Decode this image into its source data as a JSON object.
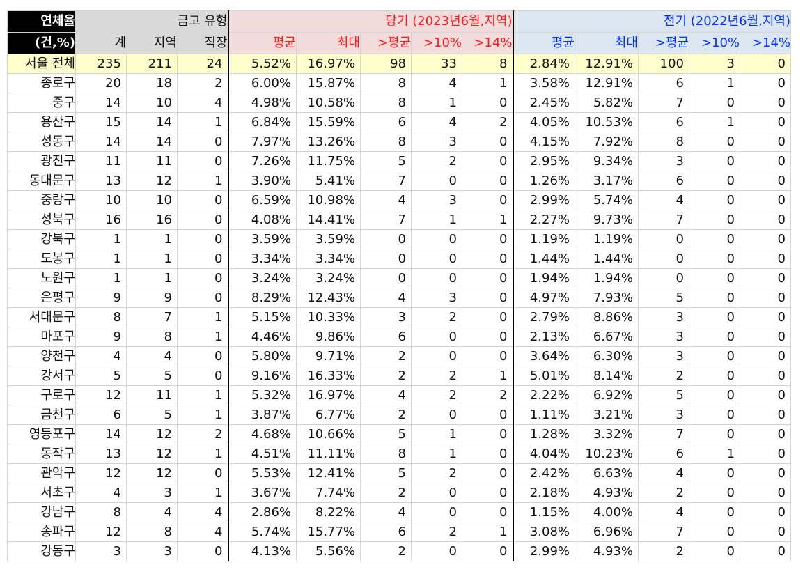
{
  "header": {
    "corner_top": "연체율",
    "corner_bottom": "(건,%)",
    "type_group": "금고 유형",
    "current_group": "당기 (2023년6월,지역)",
    "prior_group": "전기 (2022년6월,지역)",
    "sub": [
      "계",
      "지역",
      "직장",
      "평균",
      "최대",
      ">평균",
      ">10%",
      ">14%",
      "평균",
      "최대",
      ">평균",
      ">10%",
      ">14%"
    ]
  },
  "total": {
    "label": "서울 전체",
    "cells": [
      "235",
      "211",
      "24",
      "5.52%",
      "16.97%",
      "98",
      "33",
      "8",
      "2.84%",
      "12.91%",
      "100",
      "3",
      "0"
    ]
  },
  "rows": [
    {
      "label": "종로구",
      "cells": [
        "20",
        "18",
        "2",
        "6.00%",
        "15.87%",
        "8",
        "4",
        "1",
        "3.58%",
        "12.91%",
        "6",
        "1",
        "0"
      ]
    },
    {
      "label": "중구",
      "cells": [
        "14",
        "10",
        "4",
        "4.98%",
        "10.58%",
        "8",
        "1",
        "0",
        "2.45%",
        "5.82%",
        "7",
        "0",
        "0"
      ]
    },
    {
      "label": "용산구",
      "cells": [
        "15",
        "14",
        "1",
        "6.84%",
        "15.59%",
        "6",
        "4",
        "2",
        "4.05%",
        "10.53%",
        "6",
        "1",
        "0"
      ]
    },
    {
      "label": "성동구",
      "cells": [
        "14",
        "14",
        "0",
        "7.97%",
        "13.26%",
        "8",
        "3",
        "0",
        "4.15%",
        "7.92%",
        "8",
        "0",
        "0"
      ]
    },
    {
      "label": "광진구",
      "cells": [
        "11",
        "11",
        "0",
        "7.26%",
        "11.75%",
        "5",
        "2",
        "0",
        "2.95%",
        "9.34%",
        "3",
        "0",
        "0"
      ]
    },
    {
      "label": "동대문구",
      "cells": [
        "13",
        "12",
        "1",
        "3.90%",
        "5.41%",
        "7",
        "0",
        "0",
        "1.26%",
        "3.17%",
        "6",
        "0",
        "0"
      ]
    },
    {
      "label": "중랑구",
      "cells": [
        "10",
        "10",
        "0",
        "6.59%",
        "10.98%",
        "4",
        "3",
        "0",
        "2.99%",
        "5.74%",
        "4",
        "0",
        "0"
      ]
    },
    {
      "label": "성북구",
      "cells": [
        "16",
        "16",
        "0",
        "4.08%",
        "14.41%",
        "7",
        "1",
        "1",
        "2.27%",
        "9.73%",
        "7",
        "0",
        "0"
      ]
    },
    {
      "label": "강북구",
      "cells": [
        "1",
        "1",
        "0",
        "3.59%",
        "3.59%",
        "0",
        "0",
        "0",
        "1.19%",
        "1.19%",
        "0",
        "0",
        "0"
      ]
    },
    {
      "label": "도봉구",
      "cells": [
        "1",
        "1",
        "0",
        "3.34%",
        "3.34%",
        "0",
        "0",
        "0",
        "1.44%",
        "1.44%",
        "0",
        "0",
        "0"
      ]
    },
    {
      "label": "노원구",
      "cells": [
        "1",
        "1",
        "0",
        "3.24%",
        "3.24%",
        "0",
        "0",
        "0",
        "1.94%",
        "1.94%",
        "0",
        "0",
        "0"
      ]
    },
    {
      "label": "은평구",
      "cells": [
        "9",
        "9",
        "0",
        "8.29%",
        "12.43%",
        "4",
        "3",
        "0",
        "4.97%",
        "7.93%",
        "5",
        "0",
        "0"
      ]
    },
    {
      "label": "서대문구",
      "cells": [
        "8",
        "7",
        "1",
        "5.15%",
        "10.33%",
        "3",
        "2",
        "0",
        "2.79%",
        "8.86%",
        "3",
        "0",
        "0"
      ]
    },
    {
      "label": "마포구",
      "cells": [
        "9",
        "8",
        "1",
        "4.46%",
        "9.86%",
        "6",
        "0",
        "0",
        "2.13%",
        "6.67%",
        "3",
        "0",
        "0"
      ]
    },
    {
      "label": "양천구",
      "cells": [
        "4",
        "4",
        "0",
        "5.80%",
        "9.71%",
        "2",
        "0",
        "0",
        "3.64%",
        "6.30%",
        "3",
        "0",
        "0"
      ]
    },
    {
      "label": "강서구",
      "cells": [
        "5",
        "5",
        "0",
        "9.16%",
        "16.33%",
        "2",
        "2",
        "1",
        "5.01%",
        "8.14%",
        "2",
        "0",
        "0"
      ]
    },
    {
      "label": "구로구",
      "cells": [
        "12",
        "11",
        "1",
        "5.32%",
        "16.97%",
        "4",
        "2",
        "2",
        "2.22%",
        "6.92%",
        "5",
        "0",
        "0"
      ]
    },
    {
      "label": "금천구",
      "cells": [
        "6",
        "5",
        "1",
        "3.87%",
        "6.77%",
        "2",
        "0",
        "0",
        "1.11%",
        "3.21%",
        "3",
        "0",
        "0"
      ]
    },
    {
      "label": "영등포구",
      "cells": [
        "14",
        "12",
        "2",
        "4.68%",
        "10.66%",
        "5",
        "1",
        "0",
        "1.28%",
        "3.32%",
        "7",
        "0",
        "0"
      ]
    },
    {
      "label": "동작구",
      "cells": [
        "13",
        "12",
        "1",
        "4.51%",
        "11.11%",
        "8",
        "1",
        "0",
        "4.04%",
        "10.23%",
        "6",
        "1",
        "0"
      ]
    },
    {
      "label": "관악구",
      "cells": [
        "12",
        "12",
        "0",
        "5.53%",
        "12.41%",
        "5",
        "2",
        "0",
        "2.42%",
        "6.63%",
        "4",
        "0",
        "0"
      ]
    },
    {
      "label": "서초구",
      "cells": [
        "4",
        "3",
        "1",
        "3.67%",
        "7.74%",
        "2",
        "0",
        "0",
        "2.18%",
        "4.93%",
        "2",
        "0",
        "0"
      ]
    },
    {
      "label": "강남구",
      "cells": [
        "8",
        "4",
        "4",
        "2.86%",
        "8.22%",
        "4",
        "0",
        "0",
        "1.15%",
        "4.00%",
        "4",
        "0",
        "0"
      ]
    },
    {
      "label": "송파구",
      "cells": [
        "12",
        "8",
        "4",
        "5.74%",
        "15.77%",
        "6",
        "2",
        "1",
        "3.08%",
        "6.96%",
        "7",
        "0",
        "0"
      ]
    },
    {
      "label": "강동구",
      "cells": [
        "3",
        "3",
        "0",
        "4.13%",
        "5.56%",
        "2",
        "0",
        "0",
        "2.99%",
        "4.93%",
        "2",
        "0",
        "0"
      ]
    }
  ],
  "colors": {
    "corner_bg": "#000000",
    "type_bg": "#d9d9d9",
    "current_bg": "#f2dcdb",
    "current_text": "#ff1a1a",
    "prior_bg": "#dce6f1",
    "prior_text": "#0033ff",
    "total_bg": "#ffffcc"
  }
}
